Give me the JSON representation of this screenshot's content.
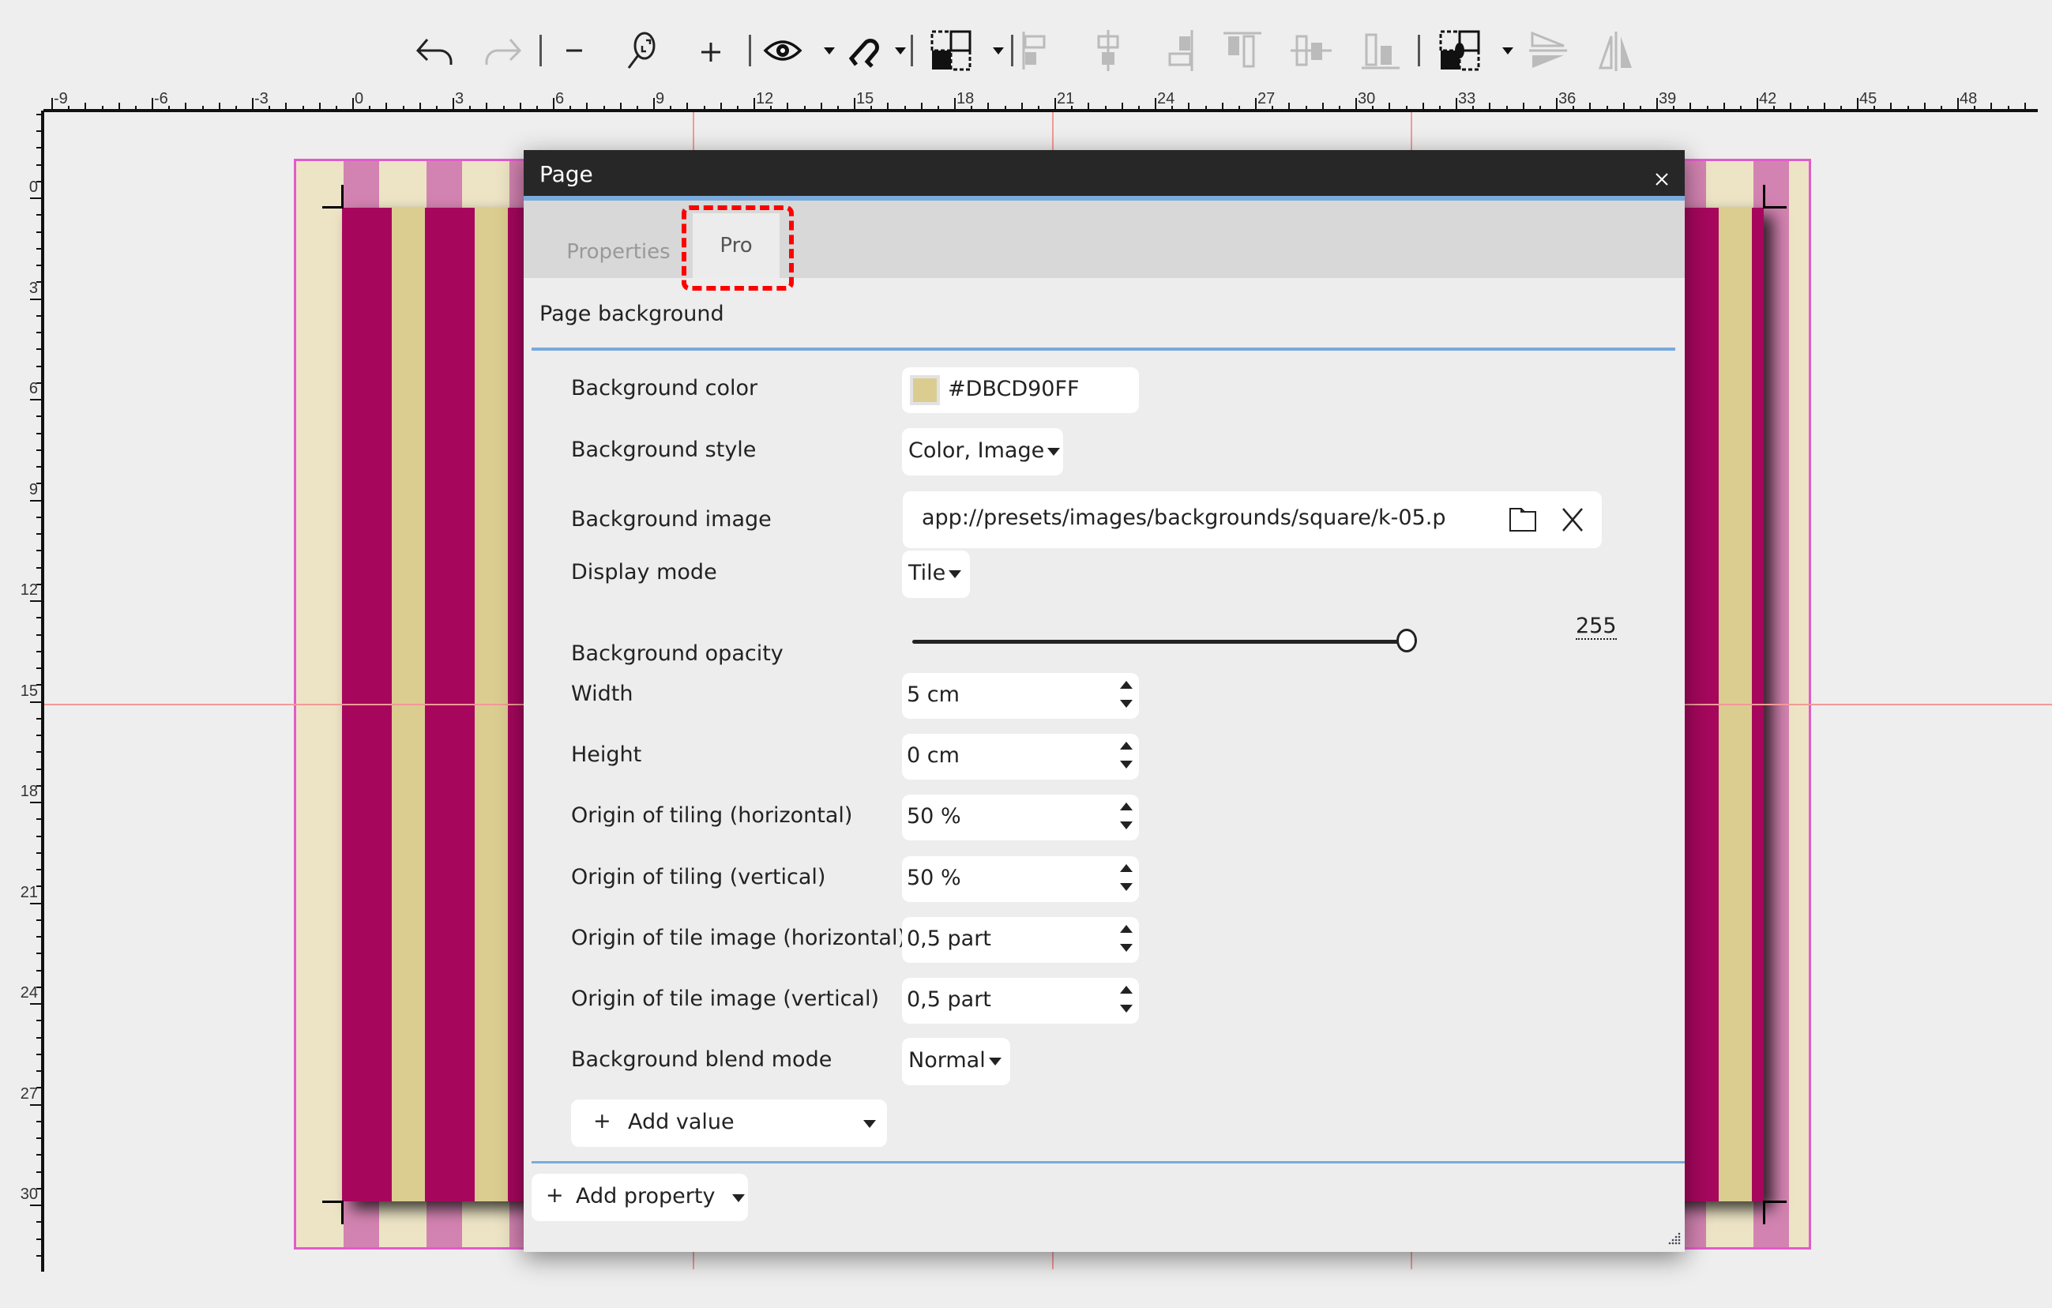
{
  "toolbar": {
    "items": [
      {
        "name": "undo-icon",
        "enabled": true
      },
      {
        "name": "redo-icon",
        "enabled": false
      },
      {
        "name": "zoom-out-icon",
        "enabled": true
      },
      {
        "name": "zoom-fit-icon",
        "enabled": true
      },
      {
        "name": "zoom-in-icon",
        "enabled": true
      },
      {
        "name": "view-icon",
        "enabled": true
      },
      {
        "name": "snap-magnet-icon",
        "enabled": true
      },
      {
        "name": "select-mode-icon",
        "enabled": true
      },
      {
        "name": "align-left-icon",
        "enabled": false
      },
      {
        "name": "align-center-horizontal-icon",
        "enabled": false
      },
      {
        "name": "align-right-icon",
        "enabled": false
      },
      {
        "name": "align-top-icon",
        "enabled": false
      },
      {
        "name": "align-center-vertical-icon",
        "enabled": false
      },
      {
        "name": "align-bottom-icon",
        "enabled": false
      },
      {
        "name": "transform-mode-icon",
        "enabled": true
      },
      {
        "name": "flip-vertical-icon",
        "enabled": false
      },
      {
        "name": "flip-horizontal-icon",
        "enabled": false
      }
    ]
  },
  "ruler": {
    "horizontal_labels": [
      "-9",
      "-6",
      "-3",
      "0",
      "3",
      "6",
      "9",
      "12",
      "15",
      "18",
      "21",
      "24",
      "27",
      "30",
      "33",
      "36",
      "39",
      "42",
      "45",
      "48"
    ],
    "vertical_labels": [
      "0",
      "3",
      "6",
      "9",
      "12",
      "15",
      "18",
      "21",
      "24",
      "27",
      "30"
    ]
  },
  "colors": {
    "accent": "#7aaadc",
    "page_stripe_dark": "#a6075d",
    "page_stripe_light": "#dbcd90",
    "bleed_stripe_pink": "#d383b1",
    "bleed_stripe_cream": "#ede4c5",
    "highlight": "#ff0000"
  },
  "dialog": {
    "title": "Page",
    "close_label": "×",
    "tabs": [
      {
        "label": "Properties",
        "active": false
      },
      {
        "label": "Pro",
        "active": true
      }
    ],
    "section_title": "Page background",
    "fields": {
      "background_color": {
        "label": "Background color",
        "value": "#DBCD90FF",
        "swatch": "#dbcd90"
      },
      "background_style": {
        "label": "Background style",
        "value": "Color, Image"
      },
      "background_image": {
        "label": "Background image",
        "value": "app://presets/images/backgrounds/square/k-05.p"
      },
      "display_mode": {
        "label": "Display mode",
        "value": "Tile"
      },
      "background_opacity": {
        "label": "Background opacity",
        "value": "255",
        "max": 255
      },
      "width": {
        "label": "Width",
        "value": "5 cm"
      },
      "height": {
        "label": "Height",
        "value": "0 cm"
      },
      "origin_tiling_h": {
        "label": "Origin of tiling (horizontal)",
        "value": "50 %"
      },
      "origin_tiling_v": {
        "label": "Origin of tiling (vertical)",
        "value": "50 %"
      },
      "origin_tile_image_h": {
        "label": "Origin of tile image (horizontal)",
        "value": "0,5 part"
      },
      "origin_tile_image_v": {
        "label": "Origin of tile image (vertical)",
        "value": "0,5 part"
      },
      "blend_mode": {
        "label": "Background blend mode",
        "value": "Normal"
      }
    },
    "add_value_label": "Add value",
    "add_property_label": "Add property",
    "plus_glyph": "+"
  }
}
